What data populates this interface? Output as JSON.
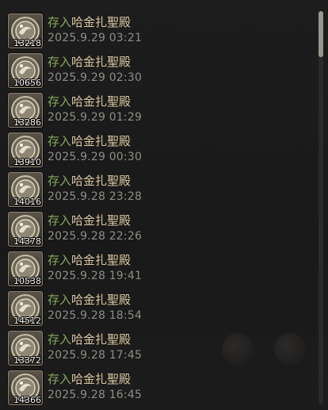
{
  "log": {
    "entries": [
      {
        "action": "存入",
        "location": "哈金扎聖殿",
        "timestamp": "2025.9.29 03:21",
        "quantity": "13218"
      },
      {
        "action": "存入",
        "location": "哈金扎聖殿",
        "timestamp": "2025.9.29 02:30",
        "quantity": "10656"
      },
      {
        "action": "存入",
        "location": "哈金扎聖殿",
        "timestamp": "2025.9.29 01:29",
        "quantity": "13286"
      },
      {
        "action": "存入",
        "location": "哈金扎聖殿",
        "timestamp": "2025.9.29 00:30",
        "quantity": "13910"
      },
      {
        "action": "存入",
        "location": "哈金扎聖殿",
        "timestamp": "2025.9.28 23:28",
        "quantity": "14016"
      },
      {
        "action": "存入",
        "location": "哈金扎聖殿",
        "timestamp": "2025.9.28 22:26",
        "quantity": "14378"
      },
      {
        "action": "存入",
        "location": "哈金扎聖殿",
        "timestamp": "2025.9.28 19:41",
        "quantity": "10538"
      },
      {
        "action": "存入",
        "location": "哈金扎聖殿",
        "timestamp": "2025.9.28 18:54",
        "quantity": "14512"
      },
      {
        "action": "存入",
        "location": "哈金扎聖殿",
        "timestamp": "2025.9.28 17:45",
        "quantity": "13372"
      },
      {
        "action": "存入",
        "location": "哈金扎聖殿",
        "timestamp": "2025.9.28 16:45",
        "quantity": "14366"
      }
    ],
    "item_icon": "silver-coin-icon"
  },
  "colors": {
    "action": "#86a95a",
    "location": "#d9c69c",
    "timestamp": "#8c8c86",
    "background": "#1a1a1a"
  },
  "scrollbar": {
    "position_fraction": 0.0
  }
}
